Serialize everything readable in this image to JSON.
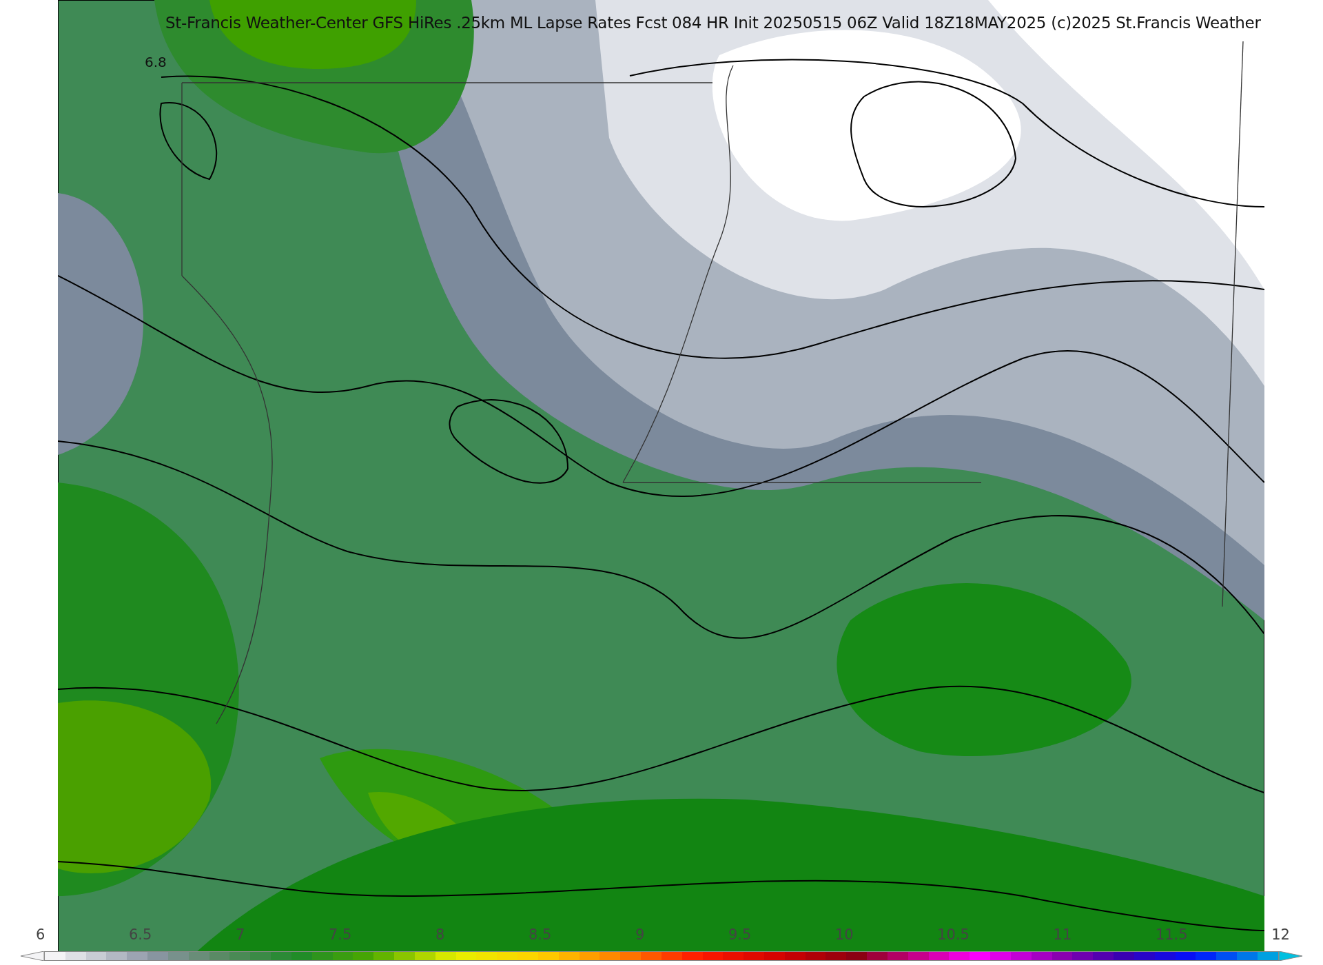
{
  "map": {
    "title": "St-Francis Weather-Center GFS HiRes .25km ML Lapse Rates  Fcst 084 HR Init 20250515 06Z  Valid 18Z18MAY2025    (c)2025 St.Francis Weather",
    "contour_label": "6.8"
  },
  "colorbar": {
    "ticks": [
      "6",
      "6.5",
      "7",
      "7.5",
      "8",
      "8.5",
      "9",
      "9.5",
      "10",
      "10.5",
      "11",
      "11.5",
      "12"
    ]
  }
}
